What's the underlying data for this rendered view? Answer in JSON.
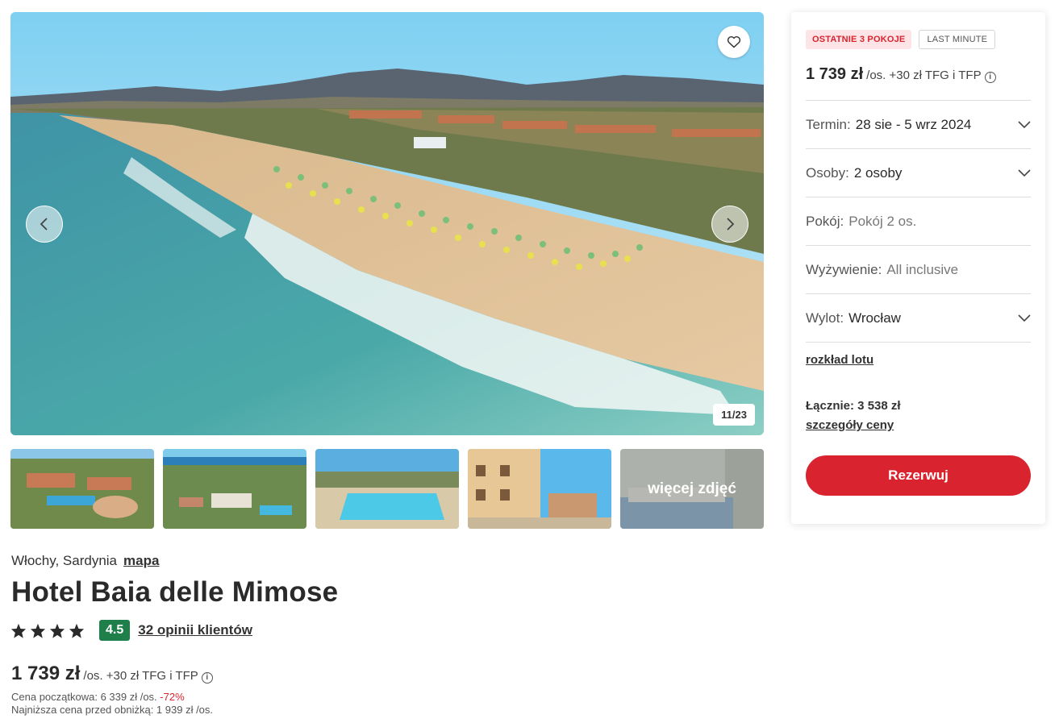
{
  "gallery": {
    "counter": "11/23",
    "favorite_icon": "heart-icon",
    "prev_icon": "chevron-left-icon",
    "next_icon": "chevron-right-icon",
    "main_image": "aerial-beach-with-umbrellas",
    "thumbnails": [
      {
        "image": "hotel-aerial-view"
      },
      {
        "image": "resort-with-pool-aerial"
      },
      {
        "image": "swimming-pool"
      },
      {
        "image": "hotel-building-facade"
      },
      {
        "image": "hotel-room-bed",
        "overlay_text": "więcej zdjęć"
      }
    ]
  },
  "hotel": {
    "location": "Włochy, Sardynia",
    "map_link": "mapa",
    "name": "Hotel Baia delle Mimose",
    "stars": 4,
    "rating": "4.5",
    "reviews_link": "32 opinii klientów",
    "price": "1 739 zł",
    "price_suffix": "/os. +30 zł TFG i TFP",
    "original_price_label": "Cena początkowa: 6 339 zł /os.",
    "discount": "-72%",
    "lowest_price_label": "Najniższa cena przed obniżką: 1 939 zł /os."
  },
  "booking": {
    "badge_last_rooms": "OSTATNIE 3 POKOJE",
    "badge_last_minute": "LAST MINUTE",
    "price": "1 739 zł",
    "price_suffix": "/os. +30 zł TFG i TFP",
    "info_icon_glyph": "i",
    "term_label": "Termin:",
    "term_value": "28 sie - 5 wrz 2024",
    "persons_label": "Osoby:",
    "persons_value": "2 osoby",
    "room_label": "Pokój:",
    "room_value": "Pokój 2 os.",
    "board_label": "Wyżywienie:",
    "board_value": "All inclusive",
    "departure_label": "Wylot:",
    "departure_value": "Wrocław",
    "flight_schedule_link": "rozkład lotu",
    "total_label": "Łącznie: 3 538 zł",
    "price_details_link": "szczegóły ceny",
    "book_button": "Rezerwuj"
  },
  "colors": {
    "accent": "#d9232e",
    "rating_green": "#1e7f4a",
    "badge_red_bg": "#fde5e7"
  }
}
